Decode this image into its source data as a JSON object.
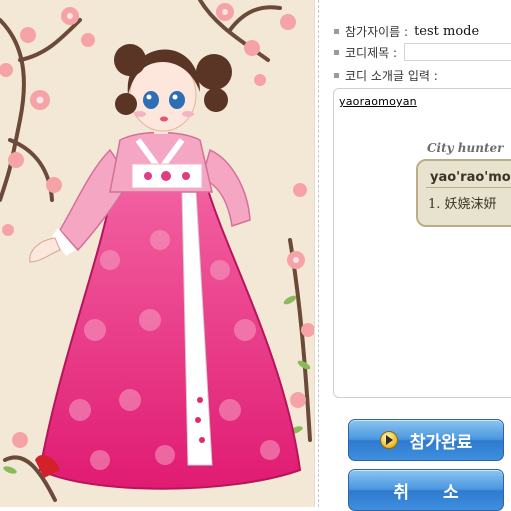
{
  "form": {
    "participant_label": "참가자이름 :",
    "participant_value": "test mode",
    "title_label": "코디제목 :",
    "title_value": "",
    "intro_label": "코디 소개글 입력 :",
    "intro_text": "yaoraomoyan"
  },
  "card": {
    "title": "City hunter",
    "name": "yao'rao'mo'",
    "item": "1. 妖娆沫妍"
  },
  "buttons": {
    "submit_label": "참가완료",
    "cancel_label": "취 소"
  },
  "colors": {
    "background": "#f3e8d6",
    "skirt": "#e8237a",
    "jacket": "#f4a6c3",
    "button_blue": "#3f8fe0"
  }
}
